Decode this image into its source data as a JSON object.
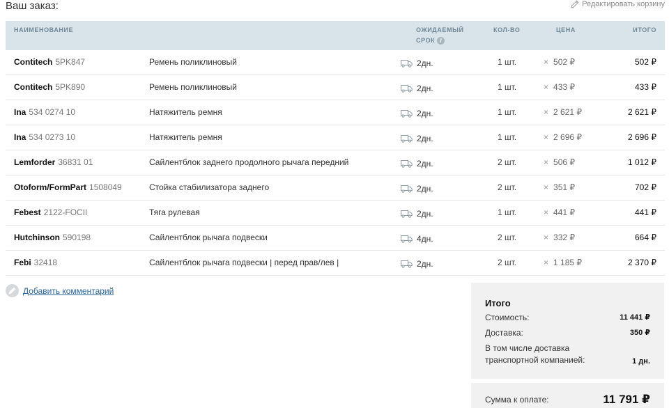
{
  "page": {
    "title": "Ваш заказ:",
    "edit_cart": "Редактировать корзину"
  },
  "table": {
    "headers": {
      "name": "НАИМЕНОВАНИЕ",
      "eta_line1": "ОЖИДАЕМЫЙ",
      "eta_line2": "СРОК",
      "info": "i",
      "qty": "КОЛ-ВО",
      "price": "ЦЕНА",
      "total": "ИТОГО"
    },
    "rows": [
      {
        "brand": "Contitech",
        "article": "5PK847",
        "desc": "Ремень поликлиновый",
        "eta": "2дн.",
        "qty": "1 шт.",
        "price": "502 ₽",
        "total": "502 ₽"
      },
      {
        "brand": "Contitech",
        "article": "5PK890",
        "desc": "Ремень поликлиновый",
        "eta": "2дн.",
        "qty": "1 шт.",
        "price": "433 ₽",
        "total": "433 ₽"
      },
      {
        "brand": "Ina",
        "article": "534 0274 10",
        "desc": "Натяжитель ремня",
        "eta": "2дн.",
        "qty": "1 шт.",
        "price": "2 621 ₽",
        "total": "2 621 ₽"
      },
      {
        "brand": "Ina",
        "article": "534 0273 10",
        "desc": "Натяжитель ремня",
        "eta": "2дн.",
        "qty": "1 шт.",
        "price": "2 696 ₽",
        "total": "2 696 ₽"
      },
      {
        "brand": "Lemforder",
        "article": "36831 01",
        "desc": "Сайлентблок заднего продолного рычага передний",
        "eta": "2дн.",
        "qty": "2 шт.",
        "price": "506 ₽",
        "total": "1 012 ₽"
      },
      {
        "brand": "Otoform/FormPart",
        "article": "1508049",
        "desc": "Стойка стабилизатора заднего",
        "eta": "2дн.",
        "qty": "2 шт.",
        "price": "351 ₽",
        "total": "702 ₽"
      },
      {
        "brand": "Febest",
        "article": "2122-FOCII",
        "desc": "Тяга рулевая",
        "eta": "2дн.",
        "qty": "1 шт.",
        "price": "441 ₽",
        "total": "441 ₽"
      },
      {
        "brand": "Hutchinson",
        "article": "590198",
        "desc": "Сайлентблок рычага подвески",
        "eta": "4дн.",
        "qty": "2 шт.",
        "price": "332 ₽",
        "total": "664 ₽"
      },
      {
        "brand": "Febi",
        "article": "32418",
        "desc": "Сайлентблок рычага подвески | перед прав/лев |",
        "eta": "2дн.",
        "qty": "2 шт.",
        "price": "1 185 ₽",
        "total": "2 370 ₽"
      }
    ],
    "price_separator": "×"
  },
  "comment": {
    "label": "Добавить комментарий"
  },
  "summary": {
    "title": "Итого",
    "cost_label": "Стоимость:",
    "cost_value": "11 441 ₽",
    "delivery_label": "Доставка:",
    "delivery_value": "350 ₽",
    "transport_label": "В том числе доставка транспортной компанией:",
    "transport_value": "1 дн.",
    "pay_label": "Сумма к оплате:",
    "pay_value": "11 791 ₽"
  },
  "icons": {
    "edit": "pencil-icon",
    "eta": "truck-icon",
    "comment": "pencil-icon",
    "price": "times-icon"
  },
  "colors": {
    "header_bg": "#d8e3ea",
    "header_text": "#6f8796",
    "link": "#2a6496",
    "summary_bg": "#f1f1f1"
  }
}
